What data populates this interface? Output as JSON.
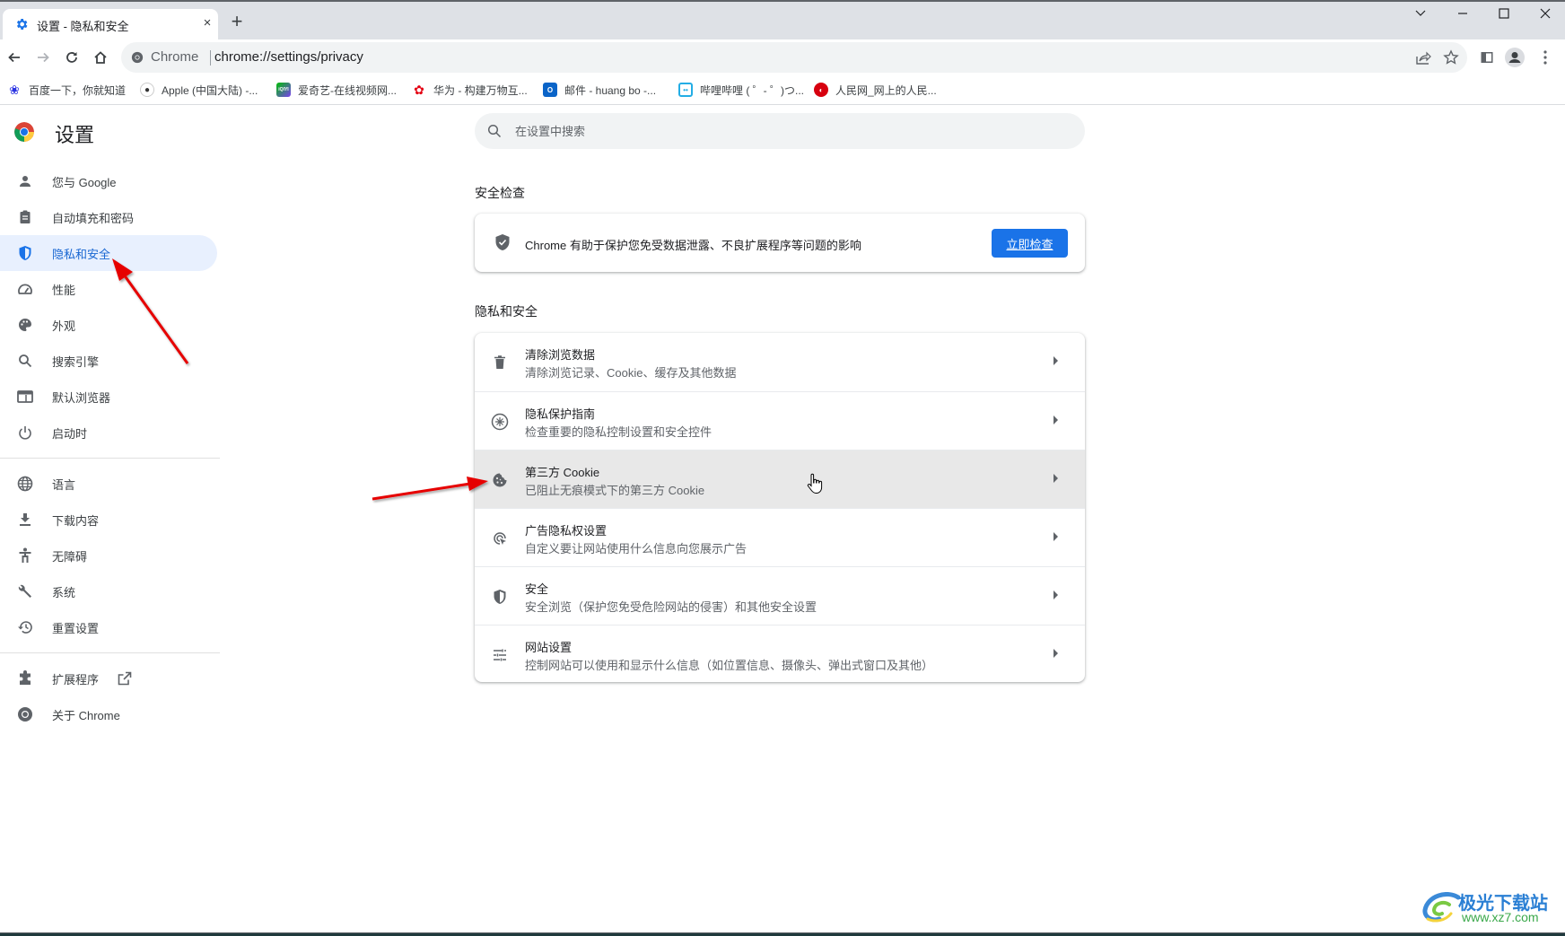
{
  "browser": {
    "tab": {
      "title": "设置 - 隐私和安全",
      "favicon": "gear-icon",
      "close_glyph": "×"
    },
    "new_tab_glyph": "+",
    "window_controls": [
      "tab-search",
      "minimize",
      "maximize",
      "close"
    ],
    "omnibox": {
      "site_label": "Chrome",
      "url": "chrome://settings/privacy"
    },
    "bookmarks": [
      {
        "label": "百度一下，你就知道",
        "icon": "baidu-icon",
        "color": "#2932e1"
      },
      {
        "label": "Apple (中国大陆) -...",
        "icon": "apple-icon",
        "color": "#555555"
      },
      {
        "label": "爱奇艺-在线视频网...",
        "icon": "iqiyi-icon",
        "color": "#00be06"
      },
      {
        "label": "华为 - 构建万物互...",
        "icon": "huawei-icon",
        "color": "#e40012"
      },
      {
        "label": "邮件 - huang bo -...",
        "icon": "outlook-icon",
        "color": "#0a64c8"
      },
      {
        "label": "哔哩哔哩 ( ゜- ゜)つ...",
        "icon": "bilibili-icon",
        "color": "#23ade5"
      },
      {
        "label": "人民网_网上的人民...",
        "icon": "people-daily-icon",
        "color": "#d7000f"
      }
    ]
  },
  "settings": {
    "title": "设置",
    "search_placeholder": "在设置中搜索",
    "sidebar": {
      "group1": [
        {
          "label": "您与 Google",
          "icon": "person-icon"
        },
        {
          "label": "自动填充和密码",
          "icon": "clipboard-icon"
        },
        {
          "label": "隐私和安全",
          "icon": "shield-icon",
          "active": true
        },
        {
          "label": "性能",
          "icon": "speedometer-icon"
        },
        {
          "label": "外观",
          "icon": "palette-icon"
        },
        {
          "label": "搜索引擎",
          "icon": "search-icon"
        },
        {
          "label": "默认浏览器",
          "icon": "browser-window-icon"
        },
        {
          "label": "启动时",
          "icon": "power-icon"
        }
      ],
      "group2": [
        {
          "label": "语言",
          "icon": "globe-icon"
        },
        {
          "label": "下载内容",
          "icon": "download-icon"
        },
        {
          "label": "无障碍",
          "icon": "accessibility-icon"
        },
        {
          "label": "系统",
          "icon": "wrench-icon"
        },
        {
          "label": "重置设置",
          "icon": "history-icon"
        }
      ],
      "group3": [
        {
          "label": "扩展程序",
          "icon": "puzzle-icon",
          "external": true
        },
        {
          "label": "关于 Chrome",
          "icon": "chrome-icon"
        }
      ]
    },
    "safety_check": {
      "heading": "安全检查",
      "text": "Chrome 有助于保护您免受数据泄露、不良扩展程序等问题的影响",
      "button": "立即检查",
      "button_color": "#1a73e8"
    },
    "privacy": {
      "heading": "隐私和安全",
      "rows": [
        {
          "title": "清除浏览数据",
          "subtitle": "清除浏览记录、Cookie、缓存及其他数据",
          "icon": "trash-icon"
        },
        {
          "title": "隐私保护指南",
          "subtitle": "检查重要的隐私控制设置和安全控件",
          "icon": "privacy-guide-icon"
        },
        {
          "title": "第三方 Cookie",
          "subtitle": "已阻止无痕模式下的第三方 Cookie",
          "icon": "cookie-icon",
          "hovered": true
        },
        {
          "title": "广告隐私权设置",
          "subtitle": "自定义要让网站使用什么信息向您展示广告",
          "icon": "ad-privacy-icon"
        },
        {
          "title": "安全",
          "subtitle": "安全浏览（保护您免受危险网站的侵害）和其他安全设置",
          "icon": "security-shield-icon"
        },
        {
          "title": "网站设置",
          "subtitle": "控制网站可以使用和显示什么信息（如位置信息、摄像头、弹出式窗口及其他）",
          "icon": "tune-icon"
        }
      ]
    }
  },
  "annotations": {
    "arrow_color": "#e60000"
  },
  "watermark": {
    "name": "极光下载站",
    "url": "www.xz7.com"
  }
}
